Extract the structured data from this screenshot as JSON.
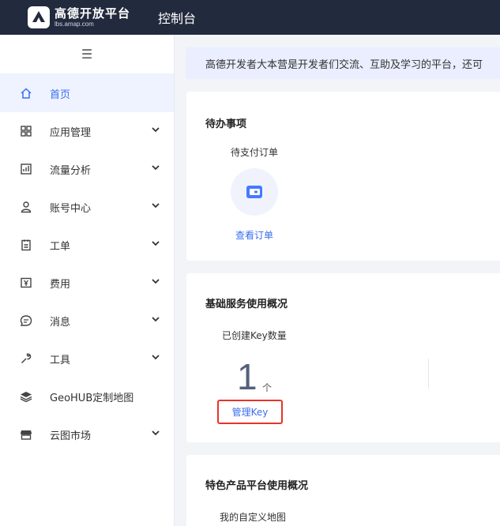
{
  "header": {
    "logo_cn": "高德开放平台",
    "logo_en": "lbs.amap.com",
    "title": "控制台"
  },
  "sidebar": {
    "toggle_icon": "menu-icon",
    "items": [
      {
        "label": "首页",
        "icon": "home-icon",
        "active": true
      },
      {
        "label": "应用管理",
        "icon": "grid-icon"
      },
      {
        "label": "流量分析",
        "icon": "chart-icon"
      },
      {
        "label": "账号中心",
        "icon": "user-icon"
      },
      {
        "label": "工单",
        "icon": "clipboard-icon"
      },
      {
        "label": "费用",
        "icon": "yen-icon"
      },
      {
        "label": "消息",
        "icon": "message-icon"
      },
      {
        "label": "工具",
        "icon": "wrench-icon"
      },
      {
        "label": "GeoHUB定制地图",
        "icon": "layers-icon"
      },
      {
        "label": "云图市场",
        "icon": "store-icon"
      }
    ]
  },
  "notice": {
    "text": "高德开发者大本营是开发者们交流、互助及学习的平台，还可"
  },
  "todo": {
    "title": "待办事项",
    "pending_label": "待支付订单",
    "link": "查看订单"
  },
  "basic_service": {
    "title": "基础服务使用概况",
    "key_label": "已创建Key数量",
    "key_count": "1",
    "key_unit": "个",
    "manage_link": "管理Key"
  },
  "featured": {
    "title": "特色产品平台使用概况",
    "custom_map_label": "我的自定义地图"
  },
  "colors": {
    "topbar": "#222a3d",
    "accent": "#3a6df0",
    "highlight": "#e8332b"
  }
}
